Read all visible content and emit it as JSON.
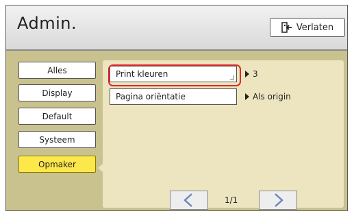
{
  "header": {
    "title": "Admin.",
    "exit_label": "Verlaten",
    "exit_icon": "exit-door-icon"
  },
  "sidebar": {
    "items": [
      {
        "label": "Alles",
        "active": false
      },
      {
        "label": "Display",
        "active": false
      },
      {
        "label": "Default",
        "active": false
      },
      {
        "label": "Systeem",
        "active": false
      },
      {
        "label": "Opmaker",
        "active": true
      }
    ]
  },
  "settings": [
    {
      "label": "Print kleuren",
      "value": "3",
      "highlighted": true
    },
    {
      "label": "Pagina oriëntatie",
      "value": "Als origin",
      "highlighted": false
    }
  ],
  "pager": {
    "page": "1/1",
    "prev_icon": "chevron-left-icon",
    "next_icon": "chevron-right-icon"
  },
  "colors": {
    "background": "#c9c28f",
    "panel": "#ede5c0",
    "active_tab": "#fce84a",
    "highlight": "#e0262b",
    "chevron": "#6d87b8"
  }
}
